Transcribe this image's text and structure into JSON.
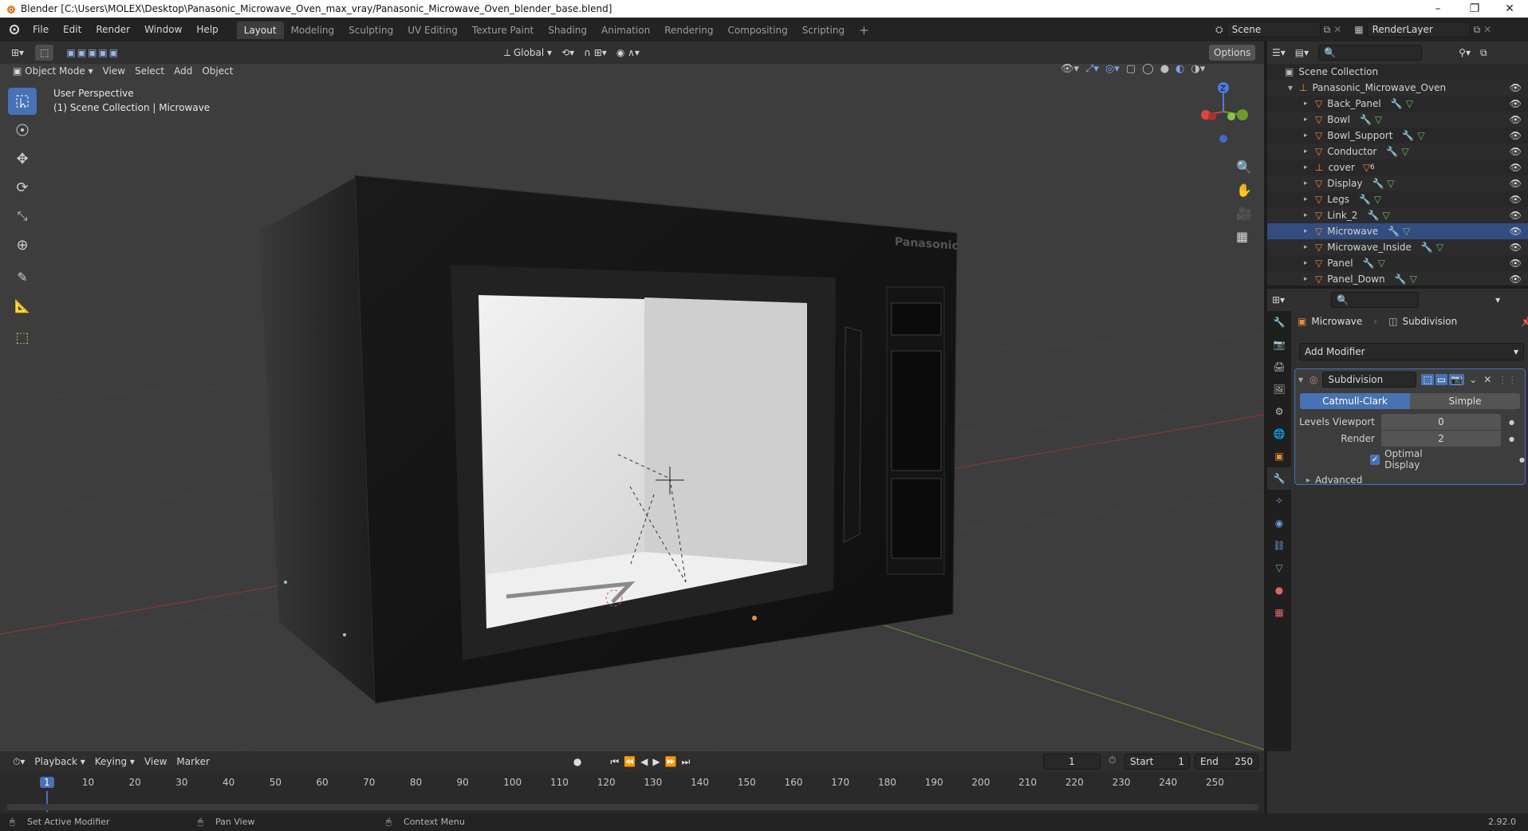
{
  "window": {
    "title": "Blender [C:\\Users\\MOLEX\\Desktop\\Panasonic_Microwave_Oven_max_vray/Panasonic_Microwave_Oven_blender_base.blend]"
  },
  "menu": [
    "File",
    "Edit",
    "Render",
    "Window",
    "Help"
  ],
  "workspaces": [
    "Layout",
    "Modeling",
    "Sculpting",
    "UV Editing",
    "Texture Paint",
    "Shading",
    "Animation",
    "Rendering",
    "Compositing",
    "Scripting"
  ],
  "active_workspace": "Layout",
  "scene": {
    "name": "Scene",
    "render_layer": "RenderLayer"
  },
  "viewport_header": {
    "mode": "Object Mode",
    "menus": [
      "View",
      "Select",
      "Add",
      "Object"
    ],
    "orientation": "Global",
    "options": "Options"
  },
  "viewport": {
    "perspective": "User Perspective",
    "collection": "(1) Scene Collection | Microwave",
    "brand": "Panasonic",
    "gizmo_axis": "Z"
  },
  "outliner": {
    "root": "Scene Collection",
    "collection": "Panasonic_Microwave_Oven",
    "objects": [
      "Back_Panel",
      "Bowl",
      "Bowl_Support",
      "Conductor",
      "cover",
      "Display",
      "Legs",
      "Link_2",
      "Microwave",
      "Microwave_Inside",
      "Panel",
      "Panel_Down"
    ],
    "cover_badge": "6"
  },
  "properties": {
    "object": "Microwave",
    "modifier_crumb": "Subdivision",
    "add_modifier": "Add Modifier",
    "modifier_name": "Subdivision",
    "type_catmull": "Catmull-Clark",
    "type_simple": "Simple",
    "levels_viewport_label": "Levels Viewport",
    "levels_viewport": "0",
    "render_label": "Render",
    "render_value": "2",
    "optimal_display": "Optimal Display",
    "advanced": "Advanced"
  },
  "timeline": {
    "menus": [
      "Playback",
      "Keying",
      "View",
      "Marker"
    ],
    "current_frame": "1",
    "start_label": "Start",
    "start": "1",
    "end_label": "End",
    "end": "250",
    "ticks": [
      "1",
      "10",
      "20",
      "30",
      "40",
      "50",
      "60",
      "70",
      "80",
      "90",
      "100",
      "110",
      "120",
      "130",
      "140",
      "150",
      "160",
      "170",
      "180",
      "190",
      "200",
      "210",
      "220",
      "230",
      "240",
      "250"
    ]
  },
  "status": {
    "left": "Set Active Modifier",
    "middle": "Pan View",
    "right": "Context Menu",
    "version": "2.92.0"
  },
  "colors": {
    "accent": "#4772b3",
    "orange": "#e88e3a",
    "green_axis": "#6b9a2e",
    "red_axis": "#a33b3b"
  }
}
